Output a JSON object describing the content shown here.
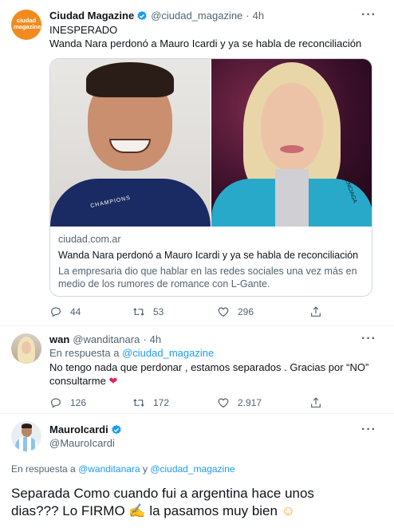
{
  "tweet1": {
    "author_name": "Ciudad Magazine",
    "author_handle": "@ciudad_magazine",
    "sep": "·",
    "time": "4h",
    "avatar_text": "ciudad magazine",
    "line1": "INESPERADO",
    "line2": "Wanda Nara perdonó a Mauro Icardi y ya se habla de reconciliación",
    "card": {
      "domain": "ciudad.com.ar",
      "title": "Wanda Nara perdonó a Mauro Icardi y ya se habla de reconciliación",
      "desc1": "La empresaria dio que hablar en las redes sociales una vez más en",
      "desc2": "medio de los rumores de romance con L-Gante.",
      "img_left_text": "CHAMPIONS",
      "img_right_text": "BALENCIAGA"
    },
    "replies": "44",
    "retweets": "53",
    "likes": "296"
  },
  "tweet2": {
    "author_name": "wan",
    "author_handle": "@wanditanara",
    "sep": "·",
    "time": "4h",
    "reply_prefix": "En respuesta a",
    "reply_to": "@ciudad_magazine",
    "line1": "No tengo nada que perdonar , estamos separados . Gracias por “NO”",
    "line2": "consultarme",
    "emoji": "❤",
    "replies": "126",
    "retweets": "172",
    "likes": "2.917"
  },
  "tweet3": {
    "author_name": "MauroIcardi",
    "author_handle": "@MauroIcardi",
    "reply_prefix": "En respuesta a",
    "reply_to_1": "@wanditanara",
    "reply_and": "y",
    "reply_to_2": "@ciudad_magazine",
    "line1": "Separada Como cuando fui a argentina hace unos",
    "line2_a": "dias??? Lo FIRMO",
    "line2_emoji1": "✍",
    "line2_b": "la pasamos muy bien",
    "line2_emoji2": "☺"
  },
  "colors": {
    "accent": "#1d9bf0",
    "text": "#0f1419",
    "muted": "#536471",
    "avatar_orange": "#f28b1e",
    "heart": "#e0245e"
  },
  "icons": [
    "more-icon",
    "verified-icon",
    "reply-icon",
    "retweet-icon",
    "like-icon",
    "share-icon"
  ]
}
